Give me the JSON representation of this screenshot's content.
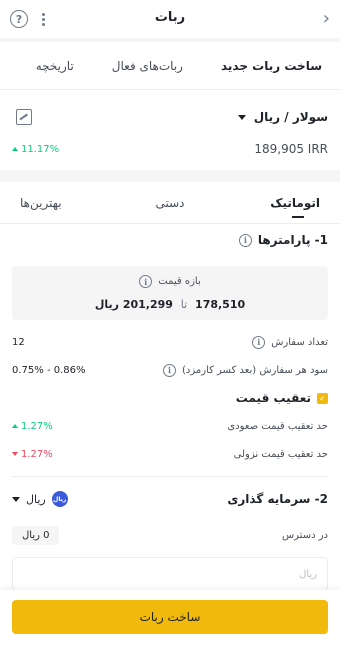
{
  "header": {
    "title": "ربات",
    "back_icon": "chevron-right-icon",
    "more_icon": "vertical-dots-icon",
    "help_icon": "question-circle-icon"
  },
  "main_tabs": [
    {
      "label": "ساخت ربات جدید",
      "active": true
    },
    {
      "label": "ربات‌های فعال",
      "active": false
    },
    {
      "label": "تاریخچه",
      "active": false
    }
  ],
  "market": {
    "pair": "سولار / ریال",
    "price": "189,905 IRR",
    "change": "11.17%",
    "chart_icon": "chart-icon"
  },
  "mode_tabs": [
    {
      "label": "اتوماتیک",
      "active": true
    },
    {
      "label": "دستی",
      "active": false
    },
    {
      "label": "بهترین‌ها",
      "active": false
    }
  ],
  "params": {
    "title": "1- پارامترها",
    "range_title": "بازه قیمت",
    "range_low": "178,510",
    "range_sep": "تا",
    "range_high": "201,299 ریال",
    "order_count_label": "تعداد سفارش",
    "order_count": "12",
    "profit_label": "سود هر سفارش (بعد کسر کارمزد)",
    "profit_value": "0.75% - 0.86%"
  },
  "trailing": {
    "label": "تعقیب قیمت",
    "checked": true,
    "up_label": "حد تعقیب قیمت صعودی",
    "up_value": "1.27%",
    "down_label": "حد تعقیب قیمت نزولی",
    "down_value": "1.27%"
  },
  "invest": {
    "title": "2- سرمایه گذاری",
    "currency": "ریال",
    "badge": "ریال",
    "available_label": "در دسترس",
    "available_value": "0 ریال",
    "input_placeholder": "ریال"
  },
  "footer": {
    "button": "ساخت ربات"
  },
  "colors": {
    "accent": "#f0b90b",
    "positive": "#0ecb81",
    "negative": "#f6465d"
  }
}
